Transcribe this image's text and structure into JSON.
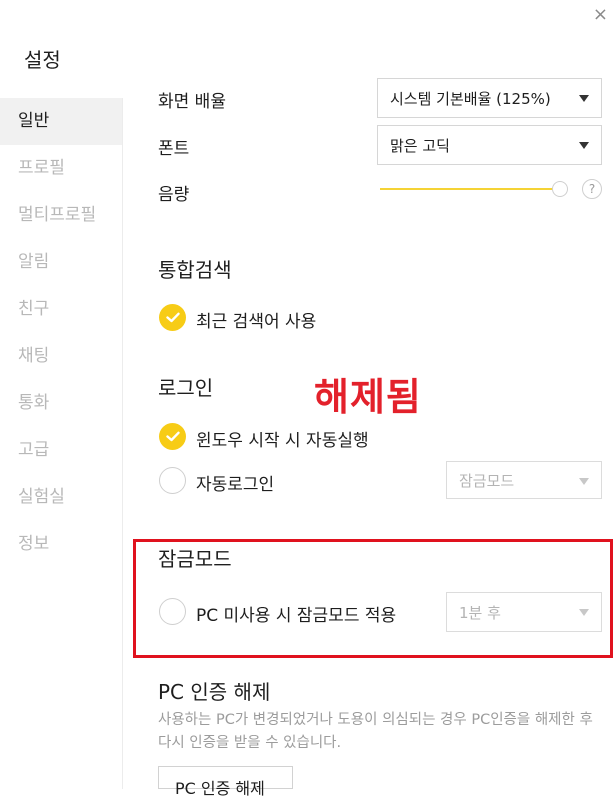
{
  "window": {
    "title": "설정",
    "close_glyph": "×"
  },
  "sidebar": {
    "items": [
      {
        "label": "일반",
        "active": true
      },
      {
        "label": "프로필"
      },
      {
        "label": "멀티프로필"
      },
      {
        "label": "알림"
      },
      {
        "label": "친구"
      },
      {
        "label": "채팅"
      },
      {
        "label": "통화"
      },
      {
        "label": "고급"
      },
      {
        "label": "실험실"
      },
      {
        "label": "정보"
      }
    ]
  },
  "display": {
    "zoom_label": "화면 배율",
    "zoom_value": "시스템 기본배율 (125%)",
    "font_label": "폰트",
    "font_value": "맑은 고딕",
    "volume_label": "음량",
    "volume_level": 1.0,
    "help_glyph": "?"
  },
  "search": {
    "heading": "통합검색",
    "recent_label": "최근 검색어 사용",
    "recent_checked": true
  },
  "login": {
    "heading": "로그인",
    "autostart_label": "윈도우 시작 시 자동실행",
    "autostart_checked": true,
    "autologin_label": "자동로그인",
    "autologin_checked": false,
    "autologin_mode_value": "잠금모드"
  },
  "annotation": {
    "text": "해제됨",
    "color": "#e3212b"
  },
  "lockmode": {
    "heading": "잠금모드",
    "idle_label": "PC 미사용 시 잠금모드 적용",
    "idle_checked": false,
    "idle_value": "1분 후"
  },
  "pc_auth": {
    "heading": "PC 인증 해제",
    "description": "사용하는 PC가 변경되었거나 도용이 의심되는 경우 PC인증을 해제한 후 다시 인증을 받을 수 있습니다.",
    "button_label": "PC 인증 해제"
  },
  "colors": {
    "accent_yellow": "#f7cc16",
    "highlight_red": "#e0121e"
  }
}
